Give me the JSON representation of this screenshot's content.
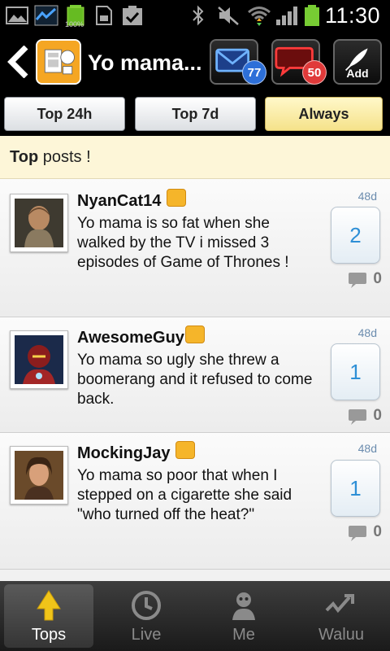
{
  "status": {
    "time": "11:30",
    "battery_label": "100%"
  },
  "header": {
    "title": "Yo mama...",
    "messages_badge": "77",
    "notifications_badge": "50",
    "add_label": "Add"
  },
  "tabs": [
    {
      "label": "Top 24h",
      "active": false
    },
    {
      "label": "Top 7d",
      "active": false
    },
    {
      "label": "Always",
      "active": true
    }
  ],
  "section": {
    "title_bold": "Top",
    "title_rest": " posts !"
  },
  "posts": [
    {
      "author": "NyanCat14",
      "text": "Yo mama is so fat when she walked by the TV i missed 3 episodes of Game of Thrones !",
      "age": "48d",
      "score": "2",
      "comments": "0"
    },
    {
      "author": "AwesomeGuy",
      "text": "Yo mama so ugly she threw a boomerang and it refused to come back.",
      "age": "48d",
      "score": "1",
      "comments": "0"
    },
    {
      "author": "MockingJay",
      "text": "Yo mama so poor that when I stepped on a cigarette she said \"who turned off the heat?\"",
      "age": "48d",
      "score": "1",
      "comments": "0"
    }
  ],
  "nav": [
    {
      "label": "Tops",
      "active": true,
      "icon": "tops-arrow-icon"
    },
    {
      "label": "Live",
      "active": false,
      "icon": "clock-icon"
    },
    {
      "label": "Me",
      "active": false,
      "icon": "person-icon"
    },
    {
      "label": "Waluu",
      "active": false,
      "icon": "waluu-logo-icon"
    }
  ],
  "colors": {
    "accent_blue": "#2e8fd6",
    "tab_active": "#f5e28a",
    "section_bg": "#fdf6d8"
  }
}
